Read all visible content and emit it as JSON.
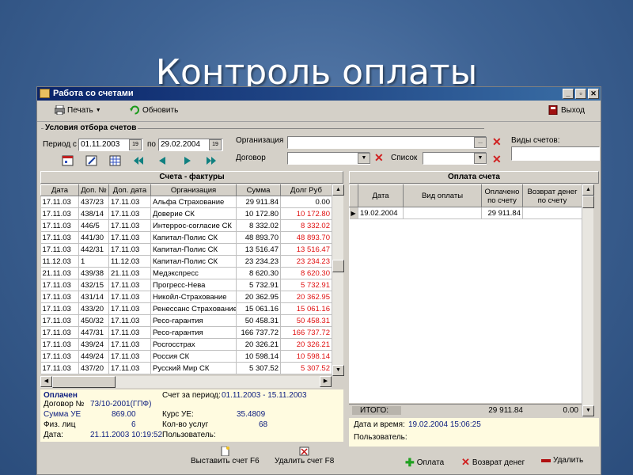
{
  "slide_title": "Контроль оплаты",
  "window": {
    "title": "Работа со счетами",
    "controls": [
      "_",
      "▫",
      "✕"
    ]
  },
  "toolbar": {
    "print_label": "Печать",
    "refresh_label": "Обновить",
    "exit_label": "Выход"
  },
  "filter": {
    "group_title": "Условия отбора счетов",
    "period_from_label": "Период с",
    "period_from_value": "01.11.2003",
    "period_to_label": "по",
    "period_to_value": "29.02.2004",
    "organization_label": "Организация",
    "organization_value": "",
    "contract_label": "Договор",
    "contract_value": "",
    "list_label": "Список",
    "list_value": "",
    "invoice_types_label": "Виды счетов:",
    "invoice_types_value": ""
  },
  "invoices": {
    "title": "Счета - фактуры",
    "columns": [
      "Дата",
      "Доп. №",
      "Доп. дата",
      "Организация",
      "Сумма",
      "Долг Руб"
    ],
    "rows": [
      [
        "17.11.03",
        "437/23",
        "17.11.03",
        "Альфа Страхование",
        "29 911.84",
        "0.00"
      ],
      [
        "17.11.03",
        "438/14",
        "17.11.03",
        "Доверие СК",
        "10 172.80",
        "10 172.80"
      ],
      [
        "17.11.03",
        "446/5",
        "17.11.03",
        "Интеррос-согласие СК",
        "8 332.02",
        "8 332.02"
      ],
      [
        "17.11.03",
        "441/30",
        "17.11.03",
        "Капитал-Полис СК",
        "48 893.70",
        "48 893.70"
      ],
      [
        "17.11.03",
        "442/31",
        "17.11.03",
        "Капитал-Полис СК",
        "13 516.47",
        "13 516.47"
      ],
      [
        "11.12.03",
        "1",
        "11.12.03",
        "Капитал-Полис СК",
        "23 234.23",
        "23 234.23"
      ],
      [
        "21.11.03",
        "439/38",
        "21.11.03",
        "Медэкспресс",
        "8 620.30",
        "8 620.30"
      ],
      [
        "17.11.03",
        "432/15",
        "17.11.03",
        "Прогресс-Нева",
        "5 732.91",
        "5 732.91"
      ],
      [
        "17.11.03",
        "431/14",
        "17.11.03",
        "Никойл-Страхование",
        "20 362.95",
        "20 362.95"
      ],
      [
        "17.11.03",
        "433/20",
        "17.11.03",
        "Ренессанс Страхование",
        "15 061.16",
        "15 061.16"
      ],
      [
        "17.11.03",
        "450/32",
        "17.11.03",
        "Ресо-гарантия",
        "50 458.31",
        "50 458.31"
      ],
      [
        "17.11.03",
        "447/31",
        "17.11.03",
        "Ресо-гарантия",
        "166 737.72",
        "166 737.72"
      ],
      [
        "17.11.03",
        "439/24",
        "17.11.03",
        "Росгосстрах",
        "20 326.21",
        "20 326.21"
      ],
      [
        "17.11.03",
        "449/24",
        "17.11.03",
        "Россия СК",
        "10 598.14",
        "10 598.14"
      ],
      [
        "17.11.03",
        "437/20",
        "17.11.03",
        "Русский Мир  СК",
        "5 307.52",
        "5 307.52"
      ]
    ]
  },
  "invoice_info": {
    "status": "Оплачен",
    "invoice_period_label": "Счет  за период:",
    "invoice_period_value": "01.11.2003 - 15.11.2003",
    "contract_label": "Договор №",
    "contract_value": "73/10-2001(ГПФ)",
    "sum_label": "Сумма УЕ",
    "sum_value": "869.00",
    "rate_label": "Курс УЕ:",
    "rate_value": "35.4809",
    "persons_label": "Физ. лиц",
    "persons_value": "6",
    "services_label": "Кол-во услуг",
    "services_value": "68",
    "date_label": "Дата:",
    "date_value": "21.11.2003 10:19:52",
    "user_label": "Пользователь:",
    "user_value": ""
  },
  "invoice_actions": {
    "issue_label": "Выставить счет F6",
    "delete_label": "Удалить счет F8"
  },
  "payments": {
    "title": "Оплата счета",
    "columns": [
      "Дата",
      "Вид оплаты",
      "Оплачено по счету",
      "Возврат денег по счету"
    ],
    "rows": [
      [
        "19.02.2004",
        "",
        "29 911.84",
        ""
      ]
    ],
    "total_label": "ИТОГО:",
    "total_paid": "29 911.84",
    "total_refund": "0.00"
  },
  "payment_info": {
    "datetime_label": "Дата и время:",
    "datetime_value": "19.02.2004 15:06:25",
    "user_label": "Пользователь:",
    "user_value": ""
  },
  "payment_actions": {
    "pay_label": "Оплата",
    "refund_label": "Возврат денег",
    "delete_label": "Удалить"
  }
}
